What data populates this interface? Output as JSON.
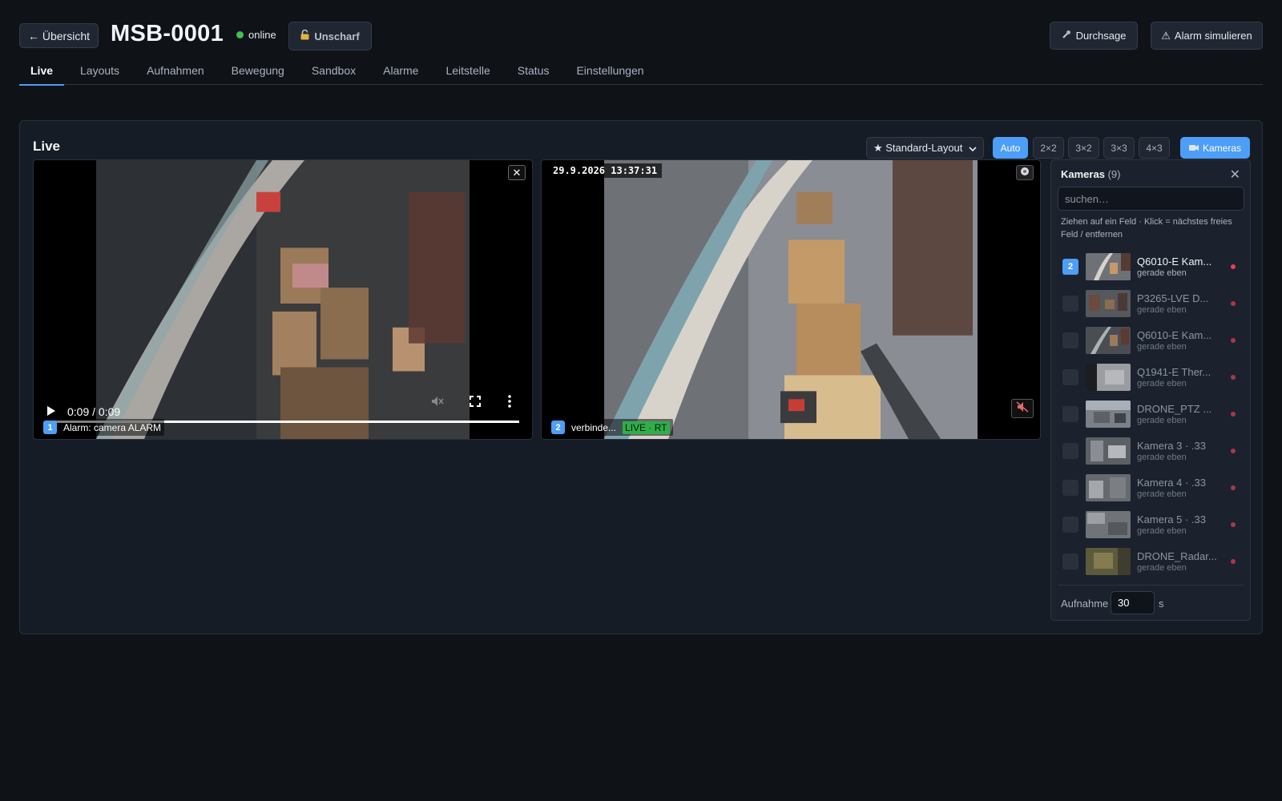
{
  "header": {
    "back_label": "← Übersicht",
    "station_id": "MSB-0001",
    "status_text": "online",
    "arm_state_label": "Unscharf",
    "announce_label": "Durchsage",
    "alarm_label": "Alarm simulieren",
    "colors": {
      "online": "#3fbf55",
      "accent": "#4d9ef7"
    }
  },
  "tabs": [
    {
      "label": "Live",
      "active": true
    },
    {
      "label": "Layouts"
    },
    {
      "label": "Aufnahmen"
    },
    {
      "label": "Bewegung"
    },
    {
      "label": "Sandbox"
    },
    {
      "label": "Alarme"
    },
    {
      "label": "Leitstelle"
    },
    {
      "label": "Status"
    },
    {
      "label": "Einstellungen"
    }
  ],
  "live": {
    "title": "Live",
    "layout_select": "★ Standard-Layout",
    "grid_options": [
      "Auto",
      "2×2",
      "3×2",
      "3×3",
      "4×3"
    ],
    "grid_selected": "Auto",
    "cameras_button": "Kameras"
  },
  "tiles": [
    {
      "slot": "1",
      "label": "Alarm: camera ALARM",
      "player_time": "0:09 / 0:09",
      "progress": 1.0
    },
    {
      "slot": "2",
      "osd_time": "29.9.2026 13:37:31",
      "label": "verbinde...",
      "live_badge": "LIVE · RT"
    }
  ],
  "camera_panel": {
    "title": "Kameras",
    "count": "(9)",
    "search_placeholder": "suchen…",
    "hint": "Ziehen auf ein Feld · Klick = nächstes freies Feld / entfernen",
    "cameras": [
      {
        "slot": "2",
        "name": "Q6010-E Kam...",
        "status": "gerade eben",
        "active": true
      },
      {
        "slot": "",
        "name": "P3265-LVE D...",
        "status": "gerade eben"
      },
      {
        "slot": "",
        "name": "Q6010-E Kam...",
        "status": "gerade eben"
      },
      {
        "slot": "",
        "name": "Q1941-E Ther...",
        "status": "gerade eben"
      },
      {
        "slot": "",
        "name": "DRONE_PTZ ...",
        "status": "gerade eben"
      },
      {
        "slot": "",
        "name": "Kamera 3 · .33",
        "status": "gerade eben"
      },
      {
        "slot": "",
        "name": "Kamera 4 · .33",
        "status": "gerade eben"
      },
      {
        "slot": "",
        "name": "Kamera 5 · .33",
        "status": "gerade eben"
      },
      {
        "slot": "",
        "name": "DRONE_Radar...",
        "status": "gerade eben"
      }
    ],
    "recording_label": "Aufnahme",
    "recording_value": "30",
    "recording_unit": "s"
  }
}
